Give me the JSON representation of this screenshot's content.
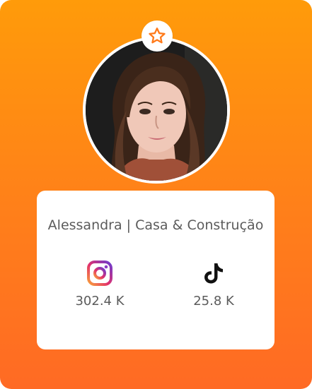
{
  "profile": {
    "name": "Alessandra | Casa & Construção",
    "avatar_icon": "avatar-photo",
    "badge_icon": "star-icon"
  },
  "stats": [
    {
      "platform": "instagram",
      "icon": "instagram-icon",
      "value": "302.4 K"
    },
    {
      "platform": "tiktok",
      "icon": "tiktok-icon",
      "value": "25.8 K"
    }
  ],
  "colors": {
    "gradient_top": "#ff9b0a",
    "gradient_bottom": "#ff6a24",
    "badge_star": "#ff7a1a",
    "text": "#5b5b5b"
  }
}
